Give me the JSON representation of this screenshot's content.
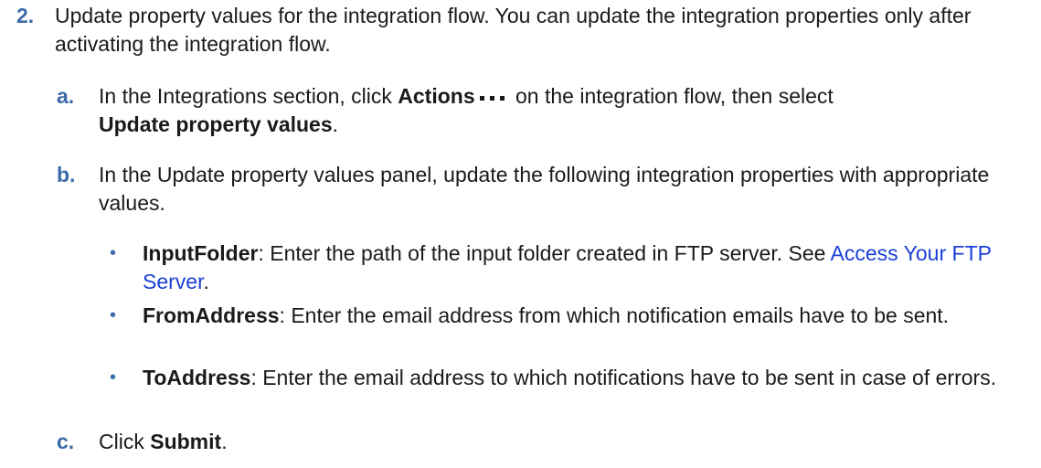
{
  "step": {
    "number": "2.",
    "text": "Update property values for the integration flow. You can update the integration properties only after activating the integration flow."
  },
  "substeps": [
    {
      "letter": "a.",
      "pre": "In the Integrations section, click ",
      "bold1": "Actions",
      "icon": "more-horizontal-dots-icon",
      "mid": " on the integration flow, then select ",
      "bold2": "Update property values",
      "post": "."
    },
    {
      "letter": "b.",
      "text": "In the Update property values panel, update the following integration properties with appropriate values."
    },
    {
      "letter": "c.",
      "pre": "Click ",
      "bold": "Submit",
      "post": "."
    }
  ],
  "bullets": [
    {
      "name": "InputFolder",
      "text": ": Enter the path of the input folder created in FTP server. See ",
      "link": "Access Your FTP Server",
      "post": "."
    },
    {
      "name": "FromAddress",
      "text": ": Enter the email address from which notification emails have to be sent."
    },
    {
      "name": "ToAddress",
      "text": ": Enter the email address to which notifications have to be sent in case of errors."
    }
  ],
  "colors": {
    "marker": "#3b6aa8",
    "link": "#1a3fd6",
    "text": "#1a1a1a"
  }
}
